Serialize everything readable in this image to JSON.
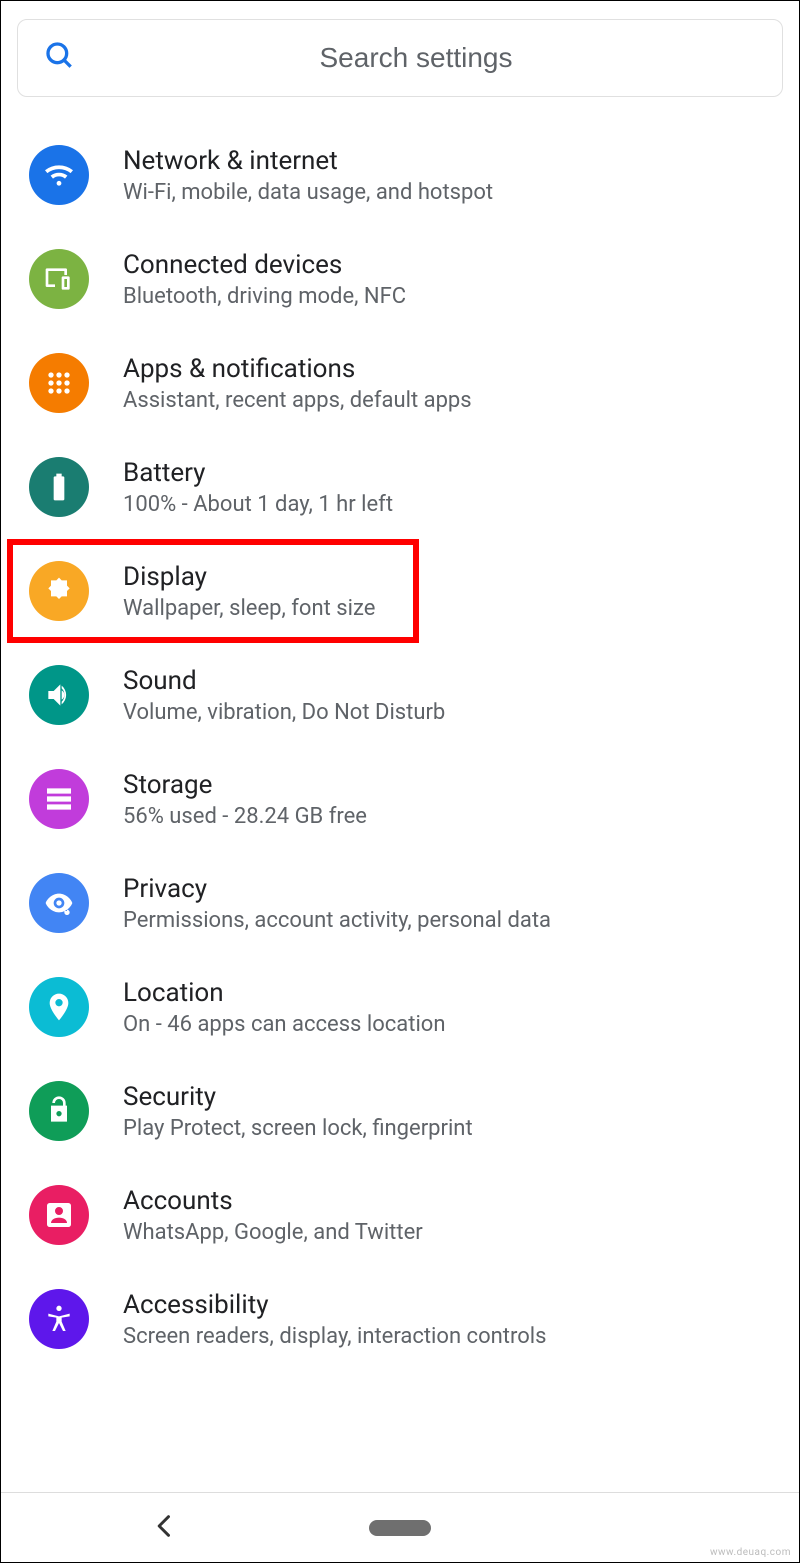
{
  "search": {
    "placeholder": "Search settings"
  },
  "items": [
    {
      "id": "network",
      "title": "Network & internet",
      "sub": "Wi-Fi, mobile, data usage, and hotspot",
      "color": "c-blue",
      "icon": "wifi-icon",
      "highlight": false
    },
    {
      "id": "connected",
      "title": "Connected devices",
      "sub": "Bluetooth, driving mode, NFC",
      "color": "c-green",
      "icon": "devices-icon",
      "highlight": false
    },
    {
      "id": "apps",
      "title": "Apps & notifications",
      "sub": "Assistant, recent apps, default apps",
      "color": "c-orange",
      "icon": "apps-icon",
      "highlight": false
    },
    {
      "id": "battery",
      "title": "Battery",
      "sub": "100% - About 1 day, 1 hr left",
      "color": "c-teal",
      "icon": "battery-icon",
      "highlight": false
    },
    {
      "id": "display",
      "title": "Display",
      "sub": "Wallpaper, sleep, font size",
      "color": "c-amber",
      "icon": "brightness-icon",
      "highlight": true
    },
    {
      "id": "sound",
      "title": "Sound",
      "sub": "Volume, vibration, Do Not Disturb",
      "color": "c-teal2",
      "icon": "sound-icon",
      "highlight": false
    },
    {
      "id": "storage",
      "title": "Storage",
      "sub": "56% used - 28.24 GB free",
      "color": "c-purple",
      "icon": "storage-icon",
      "highlight": false
    },
    {
      "id": "privacy",
      "title": "Privacy",
      "sub": "Permissions, account activity, personal data",
      "color": "c-blue2",
      "icon": "privacy-icon",
      "highlight": false
    },
    {
      "id": "location",
      "title": "Location",
      "sub": "On - 46 apps can access location",
      "color": "c-cyan",
      "icon": "location-icon",
      "highlight": false
    },
    {
      "id": "security",
      "title": "Security",
      "sub": "Play Protect, screen lock, fingerprint",
      "color": "c-green2",
      "icon": "security-icon",
      "highlight": false
    },
    {
      "id": "accounts",
      "title": "Accounts",
      "sub": "WhatsApp, Google, and Twitter",
      "color": "c-pink",
      "icon": "accounts-icon",
      "highlight": false
    },
    {
      "id": "accessibility",
      "title": "Accessibility",
      "sub": "Screen readers, display, interaction controls",
      "color": "c-indigo",
      "icon": "accessibility-icon",
      "highlight": false
    }
  ],
  "watermark": "www.deuaq.com"
}
